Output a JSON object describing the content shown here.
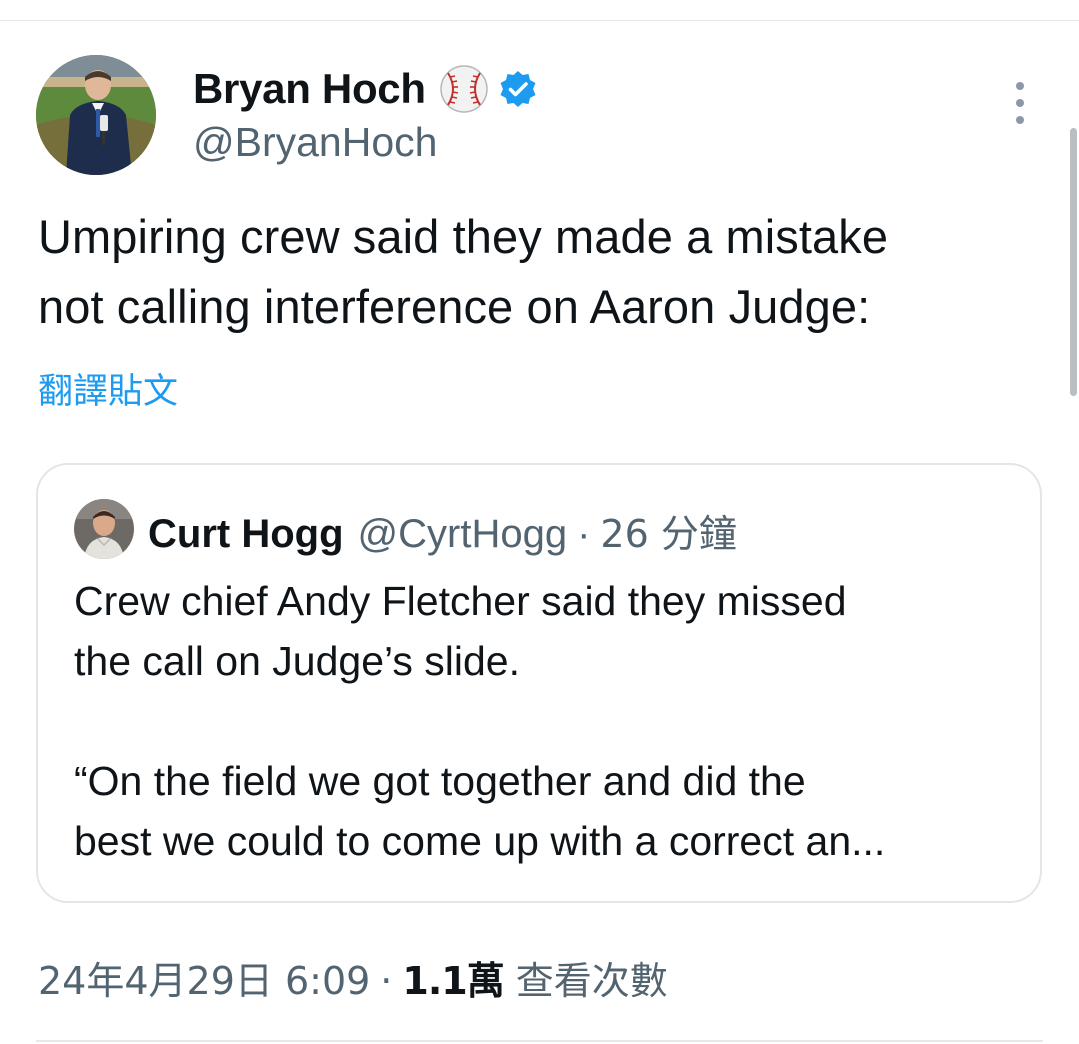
{
  "author": {
    "display_name": "Bryan Hoch",
    "handle": "@BryanHoch",
    "name_emoji": "baseball-emoji-icon",
    "verified": true
  },
  "tweet": {
    "text": "Umpiring crew said they made a mistake\nnot calling interference on Aaron Judge:",
    "translate_label": "翻譯貼文"
  },
  "quote": {
    "display_name": "Curt Hogg",
    "handle": "@CyrtHogg",
    "separator": "·",
    "time_ago": "26 分鐘",
    "text": "Crew chief Andy Fletcher said they missed\nthe call on Judge’s slide.\n\n“On the field we got together and did the\nbest we could to come up with a correct an..."
  },
  "meta": {
    "timestamp": "24年4月29日 6:09",
    "separator": "·",
    "views_count": "1.1萬",
    "views_label": "查看次數"
  },
  "colors": {
    "accent": "#1d9bf0",
    "secondary_text": "#536471",
    "primary_text": "#0f1419",
    "border": "#e1e6ea"
  }
}
